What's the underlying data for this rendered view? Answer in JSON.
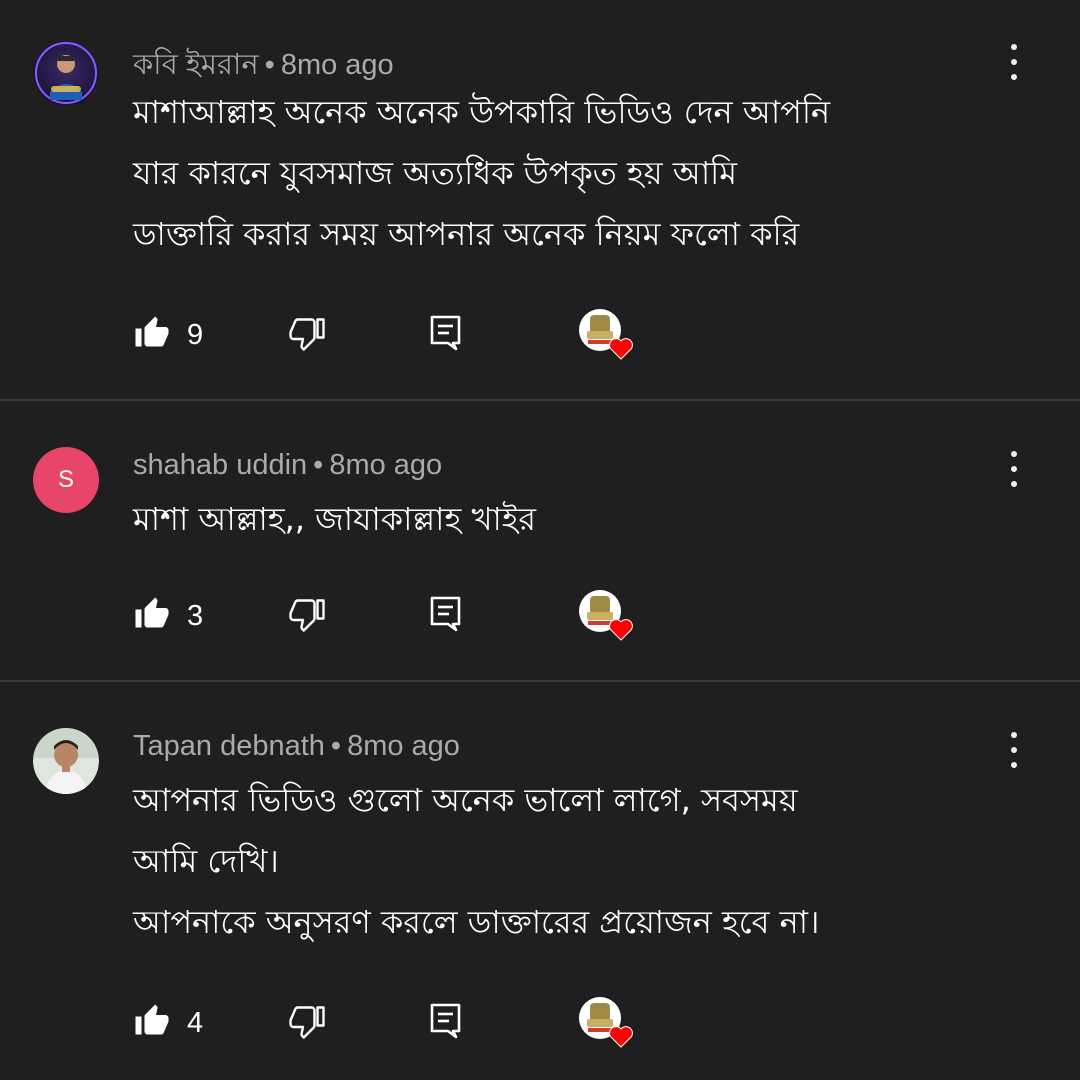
{
  "comments": [
    {
      "author": "কবি ইমরান",
      "separator": "•",
      "time": "8mo ago",
      "avatar_type": "photo",
      "text_lines": [
        "মাশাআল্লাহ অনেক অনেক উপকারি ভিডিও দেন আপনি",
        "যার কারনে যুবসমাজ অত্যধিক উপকৃত হয় আমি",
        "ডাক্তারি করার সময় আপনার অনেক নিয়ম ফলো করি"
      ],
      "likes": "9",
      "creator_hearted": true
    },
    {
      "author": "shahab uddin",
      "separator": "•",
      "time": "8mo ago",
      "avatar_type": "letter",
      "avatar_letter": "S",
      "avatar_color": "#e8456b",
      "text_lines": [
        "মাশা আল্লাহ,, জাযাকাল্লাহ খাইর"
      ],
      "likes": "3",
      "creator_hearted": true
    },
    {
      "author": "Tapan debnath",
      "separator": "•",
      "time": "8mo ago",
      "avatar_type": "photo",
      "text_lines": [
        "আপনার ভিডিও গুলো অনেক  ভালো লাগে,  সবসময়",
        "আমি দেখি।",
        "আপনাকে অনুসরণ করলে ডাক্তারের প্রয়োজন হবে না।"
      ],
      "likes": "4",
      "creator_hearted": true
    }
  ],
  "icons": {
    "like": "thumbs-up-filled-icon",
    "dislike": "thumbs-down-outline-icon",
    "reply": "reply-comment-icon",
    "more": "more-vert-icon",
    "heart": "creator-heart-icon"
  },
  "colors": {
    "background": "#1f1f1f",
    "meta_text": "#aaaaaa",
    "divider": "#383838",
    "heart": "#ff0000"
  }
}
